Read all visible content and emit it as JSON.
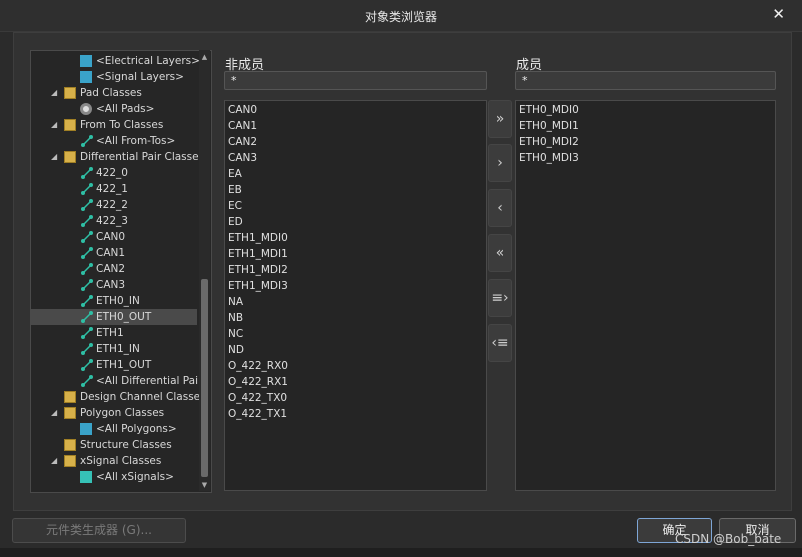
{
  "window": {
    "title": "对象类浏览器",
    "close_glyph": "✕"
  },
  "tree": {
    "items": [
      {
        "label": "<Electrical Layers>",
        "icon": "layer-icon",
        "indent": 2
      },
      {
        "label": "<Signal Layers>",
        "icon": "layer-icon",
        "indent": 2
      },
      {
        "label": "Pad Classes",
        "icon": "folder-icon",
        "indent": 1,
        "expanded": true
      },
      {
        "label": "<All Pads>",
        "icon": "pad-icon",
        "indent": 2
      },
      {
        "label": "From To Classes",
        "icon": "folder-icon",
        "indent": 1,
        "expanded": true
      },
      {
        "label": "<All From-Tos>",
        "icon": "net-icon",
        "indent": 2
      },
      {
        "label": "Differential Pair Classe",
        "icon": "folder-icon",
        "indent": 1,
        "expanded": true
      },
      {
        "label": "422_0",
        "icon": "net-icon",
        "indent": 2
      },
      {
        "label": "422_1",
        "icon": "net-icon",
        "indent": 2
      },
      {
        "label": "422_2",
        "icon": "net-icon",
        "indent": 2
      },
      {
        "label": "422_3",
        "icon": "net-icon",
        "indent": 2
      },
      {
        "label": "CAN0",
        "icon": "net-icon",
        "indent": 2
      },
      {
        "label": "CAN1",
        "icon": "net-icon",
        "indent": 2
      },
      {
        "label": "CAN2",
        "icon": "net-icon",
        "indent": 2
      },
      {
        "label": "CAN3",
        "icon": "net-icon",
        "indent": 2
      },
      {
        "label": "ETH0_IN",
        "icon": "net-icon",
        "indent": 2
      },
      {
        "label": "ETH0_OUT",
        "icon": "net-icon",
        "indent": 2,
        "selected": true
      },
      {
        "label": "ETH1",
        "icon": "net-icon",
        "indent": 2
      },
      {
        "label": "ETH1_IN",
        "icon": "net-icon",
        "indent": 2
      },
      {
        "label": "ETH1_OUT",
        "icon": "net-icon",
        "indent": 2
      },
      {
        "label": "<All Differential Pai",
        "icon": "net-icon",
        "indent": 2
      },
      {
        "label": "Design Channel Classe",
        "icon": "folder-icon",
        "indent": 1
      },
      {
        "label": "Polygon Classes",
        "icon": "folder-icon",
        "indent": 1,
        "expanded": true
      },
      {
        "label": "<All Polygons>",
        "icon": "polygon-icon",
        "indent": 2
      },
      {
        "label": "Structure Classes",
        "icon": "folder-icon",
        "indent": 1
      },
      {
        "label": "xSignal Classes",
        "icon": "folder-icon",
        "indent": 1,
        "expanded": true
      },
      {
        "label": "<All xSignals>",
        "icon": "signal-icon",
        "indent": 2
      }
    ]
  },
  "non_members": {
    "header": "非成员",
    "filter": "*",
    "items": [
      "CAN0",
      "CAN1",
      "CAN2",
      "CAN3",
      "EA",
      "EB",
      "EC",
      "ED",
      "ETH1_MDI0",
      "ETH1_MDI1",
      "ETH1_MDI2",
      "ETH1_MDI3",
      "NA",
      "NB",
      "NC",
      "ND",
      "O_422_RX0",
      "O_422_RX1",
      "O_422_TX0",
      "O_422_TX1"
    ]
  },
  "members": {
    "header": "成员",
    "filter": "*",
    "items": [
      "ETH0_MDI0",
      "ETH0_MDI1",
      "ETH0_MDI2",
      "ETH0_MDI3"
    ]
  },
  "move_buttons": [
    {
      "glyph": "»",
      "icon": "move-all-right-icon"
    },
    {
      "glyph": "›",
      "icon": "move-right-icon"
    },
    {
      "glyph": "‹",
      "icon": "move-left-icon"
    },
    {
      "glyph": "«",
      "icon": "move-all-left-icon"
    },
    {
      "glyph": "≡›",
      "icon": "move-selected-right-icon"
    },
    {
      "glyph": "‹≡",
      "icon": "move-selected-left-icon"
    }
  ],
  "footer": {
    "generator_label": "元件类生成器 (G)...",
    "ok_label": "确定",
    "cancel_label": "取消"
  },
  "watermark": "CSDN @Bob_bate",
  "colors": {
    "accent_net": "#2fbfa5",
    "folder": "#d7b14a",
    "primary_border": "#7ea6d6"
  }
}
